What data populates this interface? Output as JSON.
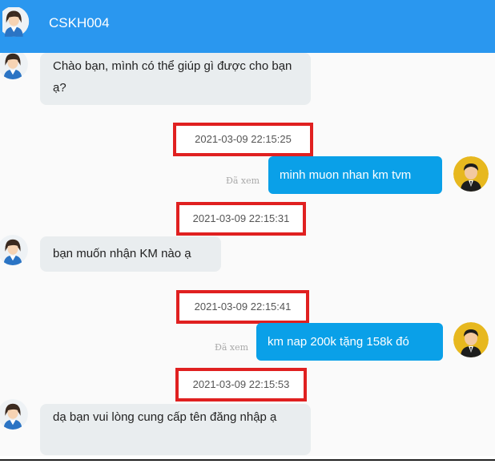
{
  "header": {
    "title": "CSKH004"
  },
  "messages": [
    {
      "sender": "agent",
      "text": "Chào bạn, mình có thể giúp gì được cho bạn ạ?"
    },
    {
      "timestamp": "2021-03-09 22:15:25",
      "sender": "user",
      "text": "minh muon nhan km tvm",
      "status": "Đã xem"
    },
    {
      "timestamp": "2021-03-09 22:15:31",
      "sender": "agent",
      "text": "bạn muốn nhận KM nào ạ"
    },
    {
      "timestamp": "2021-03-09 22:15:41",
      "sender": "user",
      "text": "km nap 200k tặng 158k đó",
      "status": "Đã xem"
    },
    {
      "timestamp": "2021-03-09 22:15:53",
      "sender": "agent",
      "text": "dạ bạn vui lòng cung cấp tên đăng nhập ạ"
    }
  ],
  "colors": {
    "header": "#2a97ef",
    "user_bubble": "#0aa0e8",
    "agent_bubble": "#e9edef",
    "highlight_box": "#e02020"
  },
  "icons": {
    "header_avatar": "female-agent-avatar-icon",
    "agent_avatar": "female-agent-avatar-icon",
    "user_avatar": "male-user-avatar-icon"
  }
}
